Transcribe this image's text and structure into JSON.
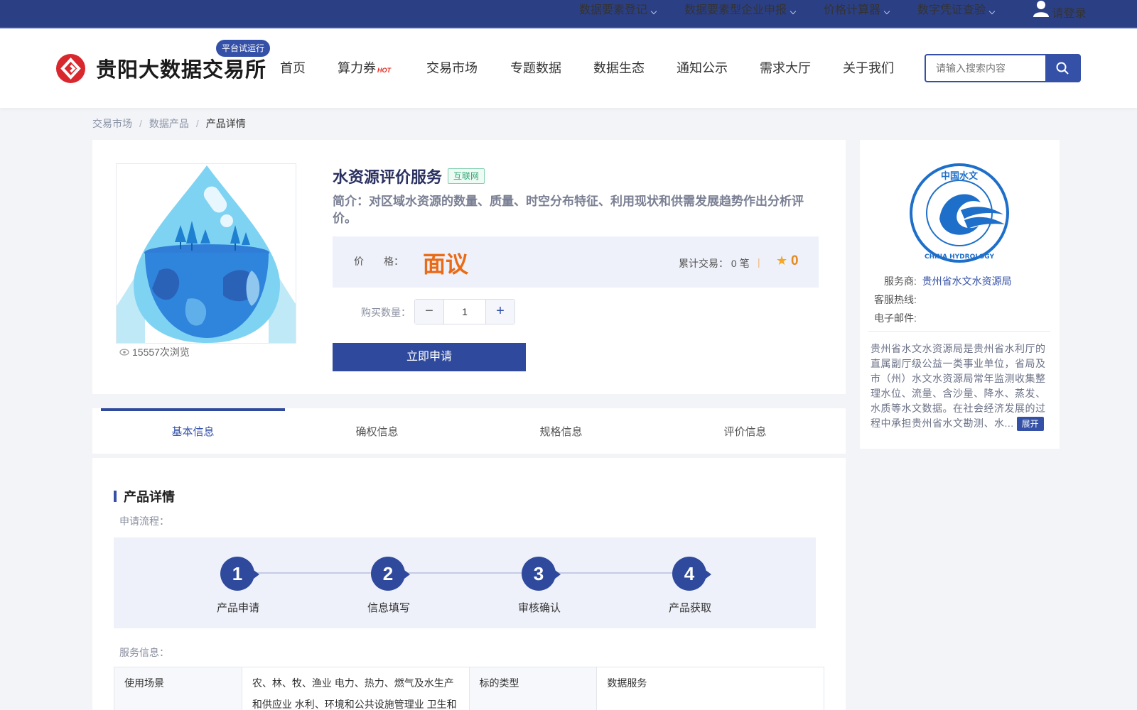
{
  "topbar": {
    "items": [
      "数据要素登记",
      "数据要素型企业申报",
      "价格计算器",
      "数字凭证查验"
    ],
    "login": "请登录"
  },
  "header": {
    "brand": "贵阳大数据交易所",
    "trial_badge": "平台试运行",
    "nav": [
      "首页",
      "算力券",
      "交易市场",
      "专题数据",
      "数据生态",
      "通知公示",
      "需求大厅",
      "关于我们"
    ],
    "hot_badge": "HOT",
    "search_placeholder": "请输入搜索内容"
  },
  "breadcrumb": [
    "交易市场",
    "数据产品",
    "产品详情"
  ],
  "product": {
    "title": "水资源评价服务",
    "tag": "互联网",
    "intro": "简介：对区域水资源的数量、质量、时空分布特征、利用现状和供需发展趋势作出分析评价。",
    "views": "15557次浏览",
    "price_label": "价　　格：",
    "price": "面议",
    "cumulative_label": "累计交易：",
    "cumulative_value": "0 笔",
    "rating": "0",
    "quantity_label": "购买数量：",
    "quantity": "1",
    "apply_button": "立即申请"
  },
  "tabs": [
    "基本信息",
    "确权信息",
    "规格信息",
    "评价信息"
  ],
  "details": {
    "section_title": "产品详情",
    "flow_label": "申请流程：",
    "steps": [
      {
        "num": "1",
        "label": "产品申请"
      },
      {
        "num": "2",
        "label": "信息填写"
      },
      {
        "num": "3",
        "label": "审核确认"
      },
      {
        "num": "4",
        "label": "产品获取"
      }
    ],
    "service_label": "服务信息：",
    "table": {
      "c1_head": "使用场景",
      "c1_value_line1": "农、林、牧、渔业 电力、热力、燃气及水生产",
      "c1_value_line2": "和供应业 水利、环境和公共设施管理业 卫生和",
      "c2_head": "标的类型",
      "c2_value": "数据服务"
    }
  },
  "provider": {
    "logo_text_top": "中国水文",
    "logo_text_bottom": "CHINA HYDROLOGY",
    "provider_label": "服务商:",
    "provider_name": "贵州省水文水资源局",
    "hotline_label": "客服热线:",
    "email_label": "电子邮件:",
    "description": "贵州省水文水资源局是贵州省水利厅的直属副厅级公益一类事业单位，省局及市（州）水文水资源局常年监测收集整理水位、流量、含沙量、降水、蒸发、水质等水文数据。在社会经济发展的过程中承担贵州省水文勘测、水...",
    "expand": "展开"
  },
  "colors": {
    "primary": "#2f4a9c",
    "topbar": "#2b3f85",
    "price": "#ea6b17",
    "brand_red": "#d9272e"
  }
}
